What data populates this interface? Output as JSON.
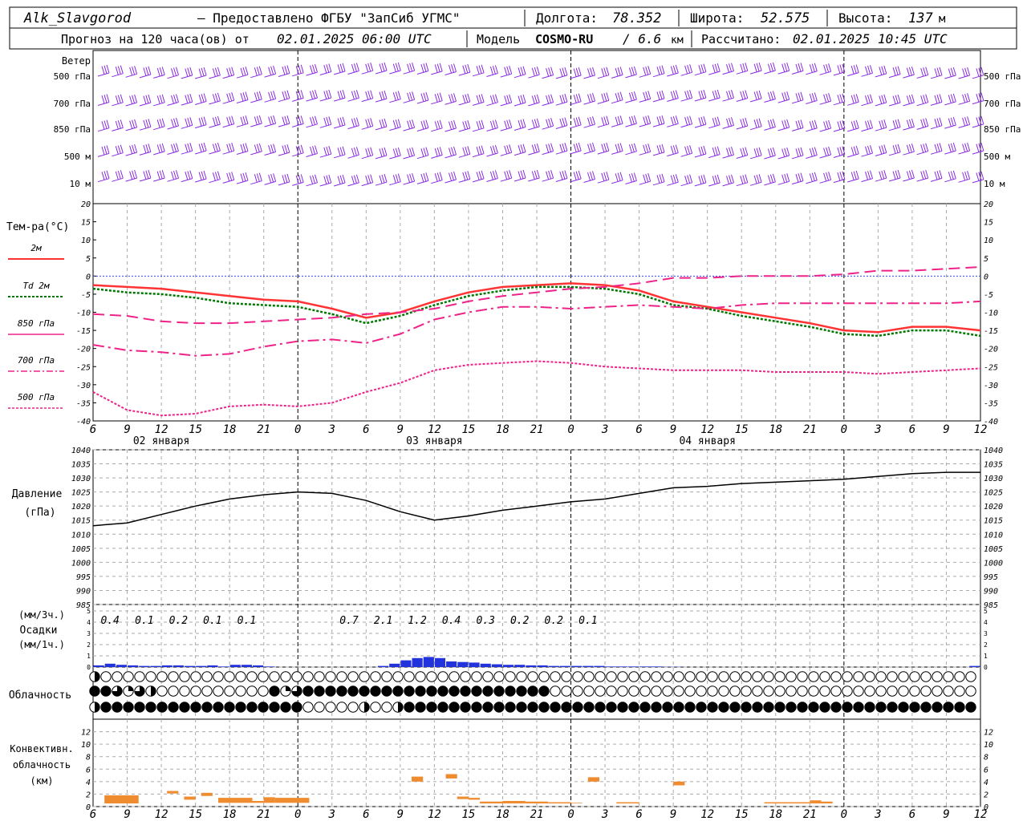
{
  "header": {
    "station": "Alk_Slavgorod",
    "provider": "– Предоставлено ФГБУ \"ЗапСиб УГМС\"",
    "lon_label": "Долгота:",
    "lon_value": "78.352",
    "lat_label": "Широта:",
    "lat_value": "52.575",
    "alt_label": "Высота:",
    "alt_value": "137",
    "alt_unit": "м",
    "forecast_label": "Прогноз на 120 часа(ов) от",
    "forecast_start": "02.01.2025 06:00 UTC",
    "model_label": "Модель",
    "model_name": "COSMO-RU",
    "model_res": "/ 6.6",
    "model_res_unit": "км",
    "calc_label": "Рассчитано:",
    "calc_value": "02.01.2025 10:45 UTC"
  },
  "time_axis": {
    "hours": [
      "6",
      "9",
      "12",
      "15",
      "18",
      "21",
      "0",
      "3",
      "6",
      "9",
      "12",
      "15",
      "18",
      "21",
      "0",
      "3",
      "6",
      "9",
      "12",
      "15",
      "18",
      "21",
      "0",
      "3",
      "6",
      "9",
      "12"
    ],
    "dates": [
      "02 января",
      "03 января",
      "04 января"
    ]
  },
  "wind_panel": {
    "title": "Ветер",
    "levels": [
      "500 гПа",
      "700 гПа",
      "850 гПа",
      "500 м",
      "10  м"
    ]
  },
  "colors": {
    "wind": "#8a2be2",
    "t2m": "#ff3333",
    "td2m": "#007700",
    "t850": "#ee2288",
    "t700": "#ee2288",
    "t500": "#ee2288",
    "zero": "#3344dd",
    "pressure": "#000000",
    "precip": "#2233dd",
    "convective": "#f08c30",
    "grid": "#aaaaaa"
  },
  "chart_data": [
    {
      "type": "line",
      "title": "Тем-ра(°С)",
      "ylim": [
        -40,
        20
      ],
      "yticks": [
        "20",
        "15",
        "10",
        "5",
        "0",
        "-5",
        "-10",
        "-15",
        "-20",
        "-25",
        "-30",
        "-35",
        "-40"
      ],
      "x": [
        0,
        3,
        6,
        9,
        12,
        15,
        18,
        21,
        24,
        27,
        30,
        33,
        36,
        39,
        42,
        45,
        48,
        51,
        54,
        57,
        60,
        63,
        66,
        69,
        72,
        75,
        78
      ],
      "series": [
        {
          "name": "2м",
          "values": [
            -2.5,
            -3,
            -3.5,
            -4.5,
            -5.5,
            -6.5,
            -7,
            -9,
            -11.5,
            -10,
            -7,
            -4.5,
            -3,
            -2.5,
            -2,
            -2.5,
            -4,
            -7,
            -8.5,
            -10,
            -11.5,
            -13,
            -15,
            -15.5,
            -14,
            -14,
            -15
          ]
        },
        {
          "name": "Td 2м",
          "values": [
            -3.5,
            -4.5,
            -5,
            -6,
            -7.5,
            -8,
            -8.5,
            -10.5,
            -13,
            -11,
            -8,
            -5.5,
            -4,
            -3,
            -3,
            -3.5,
            -5,
            -8,
            -9,
            -11,
            -12.5,
            -14,
            -16,
            -16.5,
            -15,
            -15,
            -16.5
          ]
        },
        {
          "name": "850 гПа",
          "values": [
            -10.5,
            -11,
            -12.5,
            -13,
            -13,
            -12.5,
            -12,
            -11.5,
            -10.5,
            -10,
            -9,
            -7,
            -5.5,
            -4.5,
            -3.5,
            -3,
            -2,
            -0.5,
            -0.5,
            0,
            0,
            0,
            0.5,
            1.5,
            1.5,
            2,
            2.5
          ]
        },
        {
          "name": "700 гПа",
          "values": [
            -19,
            -20.5,
            -21,
            -22,
            -21.5,
            -19.5,
            -18,
            -17.5,
            -18.5,
            -16,
            -12,
            -10,
            -8.5,
            -8.5,
            -9,
            -8.5,
            -8,
            -8.5,
            -9,
            -8,
            -7.5,
            -7.5,
            -7.5,
            -7.5,
            -7.5,
            -7.5,
            -7
          ]
        },
        {
          "name": "500 гПа",
          "values": [
            -32,
            -37,
            -38.5,
            -38,
            -36,
            -35.5,
            -36,
            -35,
            -32,
            -29.5,
            -26,
            -24.5,
            -24,
            -23.5,
            -24,
            -25,
            -25.5,
            -26,
            -26,
            -26,
            -26.5,
            -26.5,
            -26.5,
            -27,
            -26.5,
            -26,
            -25.5
          ]
        }
      ]
    },
    {
      "type": "line",
      "title": "Давление",
      "ylabel": "(гПа)",
      "ylim": [
        985,
        1040
      ],
      "yticks": [
        "1040",
        "1035",
        "1030",
        "1025",
        "1020",
        "1015",
        "1010",
        "1005",
        "1000",
        "995",
        "990",
        "985"
      ],
      "x": [
        0,
        3,
        6,
        9,
        12,
        15,
        18,
        21,
        24,
        27,
        30,
        33,
        36,
        39,
        42,
        45,
        48,
        51,
        54,
        57,
        60,
        63,
        66,
        69,
        72,
        75,
        78
      ],
      "series": [
        {
          "name": "Давление",
          "values": [
            1013,
            1014,
            1017,
            1020,
            1022.5,
            1024,
            1025,
            1024.5,
            1022,
            1018,
            1015,
            1016.5,
            1018.5,
            1020,
            1021.5,
            1022.5,
            1024.5,
            1026.5,
            1027,
            1028,
            1028.5,
            1029,
            1029.5,
            1030.5,
            1031.5,
            1032,
            1032
          ]
        }
      ]
    },
    {
      "type": "bar",
      "title": "Осадки",
      "ylabel_top": "(мм/3ч.)",
      "ylabel_bottom": "(мм/1ч.)",
      "ylim": [
        0,
        5
      ],
      "yticks": [
        "5",
        "4",
        "3",
        "2",
        "1",
        "0"
      ],
      "totals_3h": [
        {
          "x": 1.5,
          "label": "0.4"
        },
        {
          "x": 4.5,
          "label": "0.1"
        },
        {
          "x": 7.5,
          "label": "0.2"
        },
        {
          "x": 10.5,
          "label": "0.1"
        },
        {
          "x": 13.5,
          "label": "0.1"
        },
        {
          "x": 22.5,
          "label": "0.7"
        },
        {
          "x": 25.5,
          "label": "2.1"
        },
        {
          "x": 28.5,
          "label": "1.2"
        },
        {
          "x": 31.5,
          "label": "0.4"
        },
        {
          "x": 34.5,
          "label": "0.3"
        },
        {
          "x": 37.5,
          "label": "0.2"
        },
        {
          "x": 40.5,
          "label": "0.2"
        },
        {
          "x": 43.5,
          "label": "0.1"
        }
      ],
      "hourly": [
        0.15,
        0.3,
        0.2,
        0.15,
        0.1,
        0.1,
        0.15,
        0.15,
        0.1,
        0.1,
        0.15,
        0.05,
        0.2,
        0.2,
        0.15,
        0.05,
        0,
        0,
        0,
        0,
        0,
        0,
        0,
        0,
        0,
        0.1,
        0.3,
        0.6,
        0.8,
        0.9,
        0.8,
        0.5,
        0.45,
        0.4,
        0.3,
        0.25,
        0.2,
        0.2,
        0.15,
        0.15,
        0.1,
        0.1,
        0.1,
        0.1,
        0.1,
        0.05,
        0.05,
        0.05,
        0.05,
        0.05,
        0.02,
        0.02,
        0,
        0,
        0,
        0,
        0,
        0,
        0,
        0,
        0,
        0,
        0,
        0,
        0,
        0,
        0,
        0,
        0,
        0,
        0,
        0,
        0,
        0,
        0,
        0,
        0,
        0.1
      ]
    },
    {
      "type": "table",
      "title": "Облачность",
      "rows": [
        "1000000000000000000000000000000000000000000000000000000000000000000000000000000000000000000000000000000000000000000000000000000000000000",
        "4",
        "4"
      ],
      "cloud_high": [
        2,
        0,
        0,
        0,
        0,
        0,
        0,
        0,
        0,
        0,
        0,
        0,
        0,
        0,
        0,
        0,
        0,
        0,
        0,
        0,
        0,
        0,
        0,
        0,
        0,
        0,
        0,
        0,
        0,
        0,
        0,
        0,
        0,
        0,
        0,
        0,
        0,
        0,
        0,
        0,
        0,
        0,
        0,
        0,
        0,
        0,
        0,
        0,
        0,
        0,
        0,
        0,
        0,
        0,
        0,
        0,
        0,
        0,
        0,
        0,
        0,
        0,
        0,
        0,
        0,
        0,
        0,
        0,
        0,
        0,
        0,
        0,
        0,
        0,
        0,
        0,
        0,
        0,
        0,
        0
      ],
      "cloud_mid": [
        4,
        4,
        3,
        1,
        3,
        2,
        0,
        0,
        0,
        0,
        0,
        0,
        0,
        0,
        0,
        0,
        4,
        1,
        3,
        4,
        4,
        4,
        4,
        4,
        4,
        4,
        4,
        4,
        4,
        4,
        4,
        4,
        4,
        4,
        4,
        4,
        4,
        4,
        4,
        4,
        4,
        0,
        0,
        0,
        0,
        0,
        0,
        0,
        0,
        0,
        0,
        0,
        0,
        0,
        0,
        0,
        0,
        0,
        0,
        0,
        0,
        0,
        0,
        0,
        0,
        0,
        0,
        0,
        0,
        0,
        0,
        0,
        0,
        0,
        0,
        0,
        0,
        0,
        0,
        0
      ],
      "cloud_low": [
        2,
        4,
        4,
        4,
        4,
        4,
        4,
        4,
        4,
        4,
        4,
        4,
        4,
        4,
        4,
        4,
        4,
        4,
        4,
        0,
        0,
        0,
        0,
        0,
        2,
        0,
        0,
        2,
        4,
        4,
        4,
        4,
        4,
        4,
        4,
        4,
        4,
        4,
        4,
        4,
        4,
        4,
        4,
        4,
        4,
        4,
        4,
        4,
        4,
        4,
        4,
        4,
        4,
        4,
        4,
        4,
        4,
        4,
        4,
        4,
        4,
        4,
        4,
        4,
        4,
        4,
        4,
        4,
        4,
        4,
        4,
        4,
        4,
        4,
        4,
        4,
        4,
        4,
        4,
        4
      ]
    },
    {
      "type": "bar",
      "title": "Конвективн.",
      "subtitle": "облачность",
      "ylabel": "(км)",
      "ylim": [
        0,
        14
      ],
      "yticks": [
        "12",
        "10",
        "8",
        "6",
        "4",
        "2",
        "0"
      ],
      "bars": [
        {
          "x0": 1,
          "x1": 4,
          "base": 0.5,
          "top": 1.8
        },
        {
          "x0": 6.5,
          "x1": 7.5,
          "base": 2.1,
          "top": 2.5
        },
        {
          "x0": 8,
          "x1": 9,
          "base": 1.1,
          "top": 1.6
        },
        {
          "x0": 9.5,
          "x1": 10.5,
          "base": 1.7,
          "top": 2.2
        },
        {
          "x0": 11,
          "x1": 14,
          "base": 0.6,
          "top": 1.4
        },
        {
          "x0": 14,
          "x1": 15,
          "base": 0.6,
          "top": 0.9
        },
        {
          "x0": 15,
          "x1": 16,
          "base": 0.6,
          "top": 1.5
        },
        {
          "x0": 16,
          "x1": 19,
          "base": 0.6,
          "top": 1.4
        },
        {
          "x0": 28,
          "x1": 29,
          "base": 4.0,
          "top": 4.8
        },
        {
          "x0": 31,
          "x1": 32,
          "base": 4.5,
          "top": 5.2
        },
        {
          "x0": 32,
          "x1": 33,
          "base": 1.2,
          "top": 1.6
        },
        {
          "x0": 33,
          "x1": 34,
          "base": 1.1,
          "top": 1.4
        },
        {
          "x0": 34,
          "x1": 36,
          "base": 0.5,
          "top": 0.8
        },
        {
          "x0": 36,
          "x1": 38,
          "base": 0.5,
          "top": 0.9
        },
        {
          "x0": 38,
          "x1": 40,
          "base": 0.5,
          "top": 0.8
        },
        {
          "x0": 40,
          "x1": 42,
          "base": 0.5,
          "top": 0.7
        },
        {
          "x0": 42,
          "x1": 43,
          "base": 0.5,
          "top": 0.6
        },
        {
          "x0": 43.5,
          "x1": 44.5,
          "base": 4.0,
          "top": 4.7
        },
        {
          "x0": 46,
          "x1": 48,
          "base": 0.5,
          "top": 0.7
        },
        {
          "x0": 51,
          "x1": 52,
          "base": 3.4,
          "top": 4.0
        },
        {
          "x0": 59,
          "x1": 63,
          "base": 0.5,
          "top": 0.7
        },
        {
          "x0": 63,
          "x1": 64,
          "base": 0.5,
          "top": 1.0
        },
        {
          "x0": 64,
          "x1": 65,
          "base": 0.5,
          "top": 0.8
        }
      ]
    }
  ]
}
